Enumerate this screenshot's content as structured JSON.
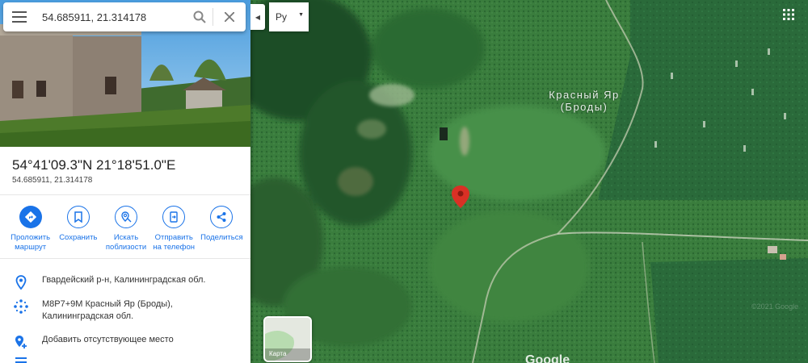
{
  "search": {
    "value": "54.685911, 21.314178"
  },
  "place": {
    "title": "54°41'09.3\"N 21°18'51.0\"E",
    "decimal": "54.685911, 21.314178"
  },
  "actions": [
    {
      "icon": "directions-icon",
      "label": "Проложить маршрут"
    },
    {
      "icon": "bookmark-icon",
      "label": "Сохранить"
    },
    {
      "icon": "nearby-search-icon",
      "label": "Искать поблизости"
    },
    {
      "icon": "send-to-phone-icon",
      "label": "Отправить на телефон"
    },
    {
      "icon": "share-icon",
      "label": "Поделиться"
    }
  ],
  "info": {
    "address": "Гвардейский р-н, Калининградская обл.",
    "plus_code": "M8P7+9M Красный Яр (Броды), Калининградская обл.",
    "add_place": "Добавить отсутствующее место"
  },
  "map": {
    "place_label": "Красный Яр (Броды)",
    "layer_select": "Ру",
    "minimap_label": "Карта",
    "google_mark": "Google",
    "copyright": "©2021 Google",
    "pin_color": "#d93025",
    "accent_color": "#1a73e8"
  }
}
